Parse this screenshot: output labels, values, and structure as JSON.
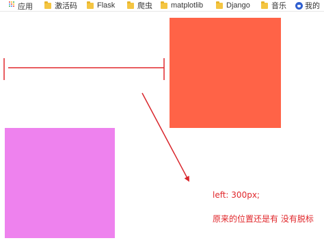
{
  "bookmarks_bar": {
    "items": [
      {
        "label": "应用",
        "icon": "apps-icon"
      },
      {
        "label": "激活码",
        "icon": "folder-icon"
      },
      {
        "label": "Flask",
        "icon": "folder-icon"
      },
      {
        "label": "爬虫",
        "icon": "folder-icon"
      },
      {
        "label": "matplotlib",
        "icon": "folder-icon"
      },
      {
        "label": "Django",
        "icon": "folder-icon"
      },
      {
        "label": "音乐",
        "icon": "folder-icon"
      },
      {
        "label": "我的",
        "icon": "baidu-icon"
      }
    ]
  },
  "annotations": {
    "offset_note": "left: 300px;",
    "explanation_note": "原来的位置还是有  没有脱标"
  },
  "colors": {
    "orange_box": "#ff6347",
    "violet_box": "#ee82ee",
    "annotation_red": "#e0262a"
  }
}
